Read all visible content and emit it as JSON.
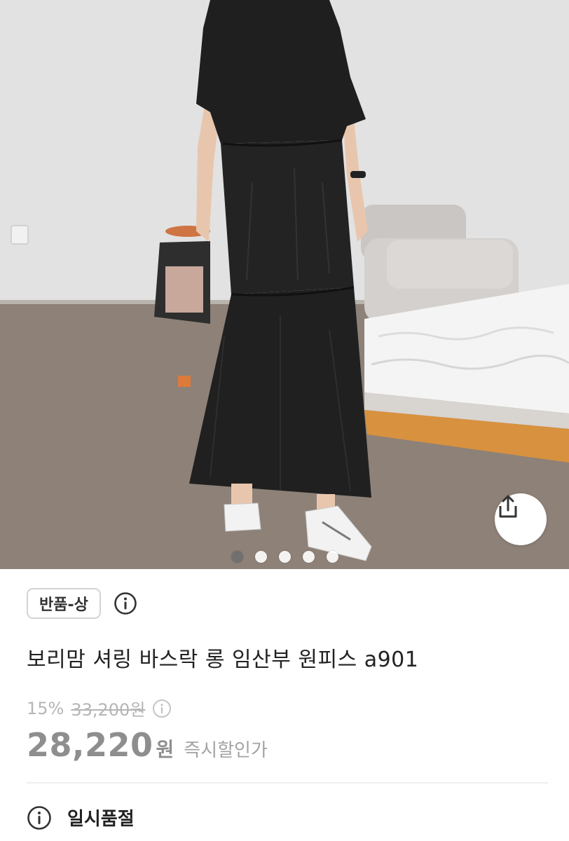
{
  "product_image": {
    "alt_icon": "product-photo",
    "carousel": {
      "total": 5,
      "active_index": 0
    }
  },
  "share": {
    "icon": "share-icon"
  },
  "badge": {
    "label": "반품-상",
    "info_icon": "info-icon"
  },
  "product": {
    "title": "보리맘 셔링 바스락 롱 임산부 원피스 a901"
  },
  "price": {
    "discount_rate": "15%",
    "original": "33,200원",
    "sale_amount": "28,220",
    "currency": "원",
    "note": "즉시할인가"
  },
  "status": {
    "icon": "info-icon",
    "label": "일시품절"
  },
  "colors": {
    "price_gray": "#8e8e8e",
    "muted_gray": "#b5b5b5",
    "divider": "#eeeeee"
  }
}
